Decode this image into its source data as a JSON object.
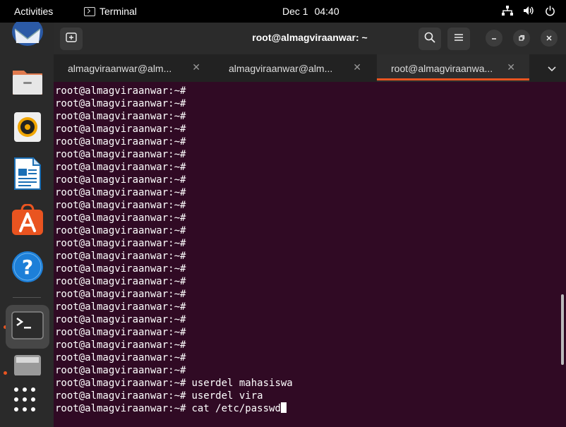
{
  "topbar": {
    "activities": "Activities",
    "app_name": "Terminal",
    "date": "Dec 1",
    "time": "04:40"
  },
  "dock": {
    "items": [
      "thunderbird-icon",
      "files-icon",
      "rhythmbox-icon",
      "libreoffice-writer-icon",
      "app-center-icon",
      "help-icon",
      "terminal-icon",
      "drive-icon"
    ],
    "active": "terminal-icon"
  },
  "window": {
    "title": "root@almagviraanwar: ~",
    "tabs": [
      {
        "label": "almagviraanwar@alm..."
      },
      {
        "label": "almagviraanwar@alm..."
      },
      {
        "label": "root@almagviraanwa..."
      }
    ],
    "active_tab": 2
  },
  "terminal": {
    "prompt": "root@almagviraanwar:~#",
    "lines": [
      {
        "prompt": "root@almagviraanwar:~#",
        "cmd": ""
      },
      {
        "prompt": "root@almagviraanwar:~#",
        "cmd": ""
      },
      {
        "prompt": "root@almagviraanwar:~#",
        "cmd": ""
      },
      {
        "prompt": "root@almagviraanwar:~#",
        "cmd": ""
      },
      {
        "prompt": "root@almagviraanwar:~#",
        "cmd": ""
      },
      {
        "prompt": "root@almagviraanwar:~#",
        "cmd": ""
      },
      {
        "prompt": "root@almagviraanwar:~#",
        "cmd": ""
      },
      {
        "prompt": "root@almagviraanwar:~#",
        "cmd": ""
      },
      {
        "prompt": "root@almagviraanwar:~#",
        "cmd": ""
      },
      {
        "prompt": "root@almagviraanwar:~#",
        "cmd": ""
      },
      {
        "prompt": "root@almagviraanwar:~#",
        "cmd": ""
      },
      {
        "prompt": "root@almagviraanwar:~#",
        "cmd": ""
      },
      {
        "prompt": "root@almagviraanwar:~#",
        "cmd": ""
      },
      {
        "prompt": "root@almagviraanwar:~#",
        "cmd": ""
      },
      {
        "prompt": "root@almagviraanwar:~#",
        "cmd": ""
      },
      {
        "prompt": "root@almagviraanwar:~#",
        "cmd": ""
      },
      {
        "prompt": "root@almagviraanwar:~#",
        "cmd": ""
      },
      {
        "prompt": "root@almagviraanwar:~#",
        "cmd": ""
      },
      {
        "prompt": "root@almagviraanwar:~#",
        "cmd": ""
      },
      {
        "prompt": "root@almagviraanwar:~#",
        "cmd": ""
      },
      {
        "prompt": "root@almagviraanwar:~#",
        "cmd": ""
      },
      {
        "prompt": "root@almagviraanwar:~#",
        "cmd": ""
      },
      {
        "prompt": "root@almagviraanwar:~#",
        "cmd": ""
      },
      {
        "prompt": "root@almagviraanwar:~#",
        "cmd": "userdel mahasiswa"
      },
      {
        "prompt": "root@almagviraanwar:~#",
        "cmd": "userdel vira"
      },
      {
        "prompt": "root@almagviraanwar:~#",
        "cmd": "cat /etc/passwd",
        "cursor": true
      }
    ]
  },
  "colors": {
    "terminal_bg": "#300a24",
    "accent": "#e95420"
  }
}
